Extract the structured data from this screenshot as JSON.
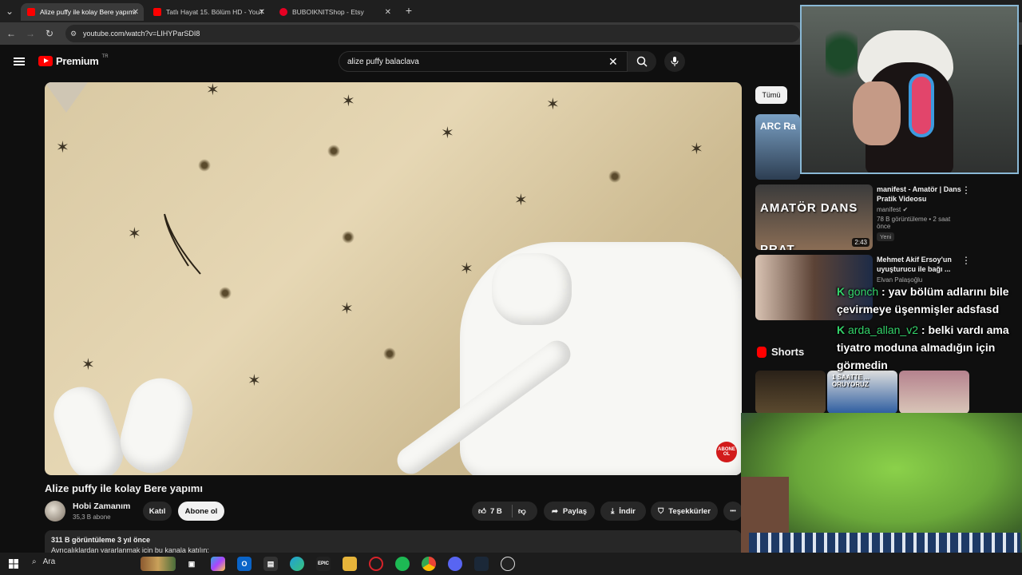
{
  "browser": {
    "tabs": [
      {
        "label": "Alize puffy ile kolay Bere yapımı",
        "favicon": "youtube-icon",
        "color": "#ff0000",
        "active": true
      },
      {
        "label": "Tatlı Hayat 15. Bölüm HD - YouT",
        "favicon": "youtube-icon",
        "color": "#ff0000",
        "active": false
      },
      {
        "label": "BUBOIKNITShop - Etsy",
        "favicon": "pinterest-icon",
        "color": "#e60023",
        "active": false
      }
    ],
    "new_tab": "+",
    "url": "youtube.com/watch?v=LIHYParSDI8"
  },
  "youtube": {
    "logo_text": "Premium",
    "logo_suffix": "TR",
    "search_value": "alize puffy balaclava",
    "chip_all": "Tümü"
  },
  "video": {
    "title": "Alize puffy ile kolay Bere yapımı",
    "channel": "Hobi Zamanım",
    "subscribers": "35,3 B abone",
    "join_label": "Katıl",
    "subscribe_label": "Abone ol",
    "likes": "7 B",
    "share_label": "Paylaş",
    "download_label": "İndir",
    "thanks_label": "Teşekkürler",
    "more": "•••",
    "watermark": "ABONE OL",
    "views_meta": "311 B görüntüleme  3 yıl önce",
    "desc_line": "Avrıcalıklardan yararlanmak için bu kanala katılın:"
  },
  "sidebar": {
    "recommendations": [
      {
        "thumb_text": "ARC Ra",
        "title": "",
        "channel": "",
        "meta": ""
      },
      {
        "thumb_text": "AMATÖR DANS PRAT",
        "duration": "2:43",
        "title": "manifest - Amatör | Dans Pratik Videosu",
        "channel": "manifest",
        "meta": "78 B görüntüleme • 2 saat önce",
        "badge": "Yeni"
      },
      {
        "thumb_text": "",
        "title": "Mehmet Akif Ersoy'un uyuşturucu ile bağı ...",
        "channel": "Elvan Palaşoğlu",
        "meta": "",
        "badge": ""
      }
    ],
    "shorts_label": "Shorts",
    "shorts_overlay": "1 SAATTE ... ORUYORUZ"
  },
  "chat": {
    "messages": [
      {
        "user": "gonch",
        "text": "yav bölüm adlarını bile çevirmeye üşenmişler adsfasd"
      },
      {
        "user": "arda_allan_v2",
        "text": "belki vardı ama tiyatro moduna almadığın için görmedin"
      }
    ]
  },
  "taskbar": {
    "search_label": "Ara"
  }
}
